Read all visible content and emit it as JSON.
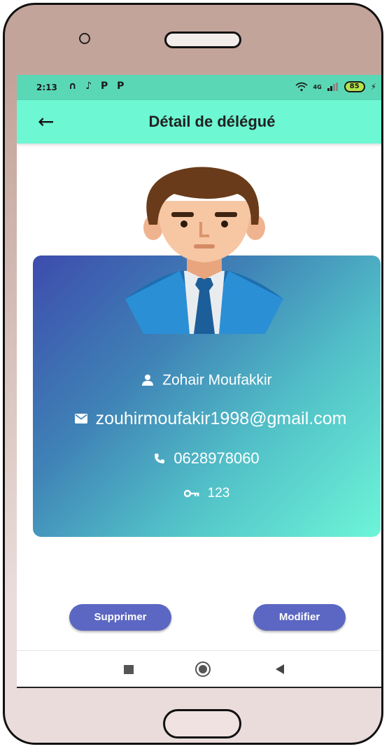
{
  "status_bar": {
    "time": "2:13",
    "left_icons": "∩ ♪ P P",
    "network": "4G",
    "battery": "85",
    "charging": "⚡"
  },
  "app_bar": {
    "back_glyph": "←",
    "title": "Détail de délégué"
  },
  "delegate": {
    "name": "Zohair Moufakkir",
    "email": "zouhirmoufakir1998@gmail.com",
    "phone": "0628978060",
    "password": "123"
  },
  "actions": {
    "delete_label": "Supprimer",
    "edit_label": "Modifier"
  },
  "colors": {
    "app_bar": "#6df7d3",
    "status_bar": "#5ad8b5",
    "button": "#5b67c2",
    "card_start": "#3d4cad",
    "card_end": "#6df5d8"
  },
  "icons": {
    "back": "arrow-left-icon",
    "name": "person-icon",
    "email": "mail-icon",
    "phone": "phone-icon",
    "password": "key-icon"
  }
}
